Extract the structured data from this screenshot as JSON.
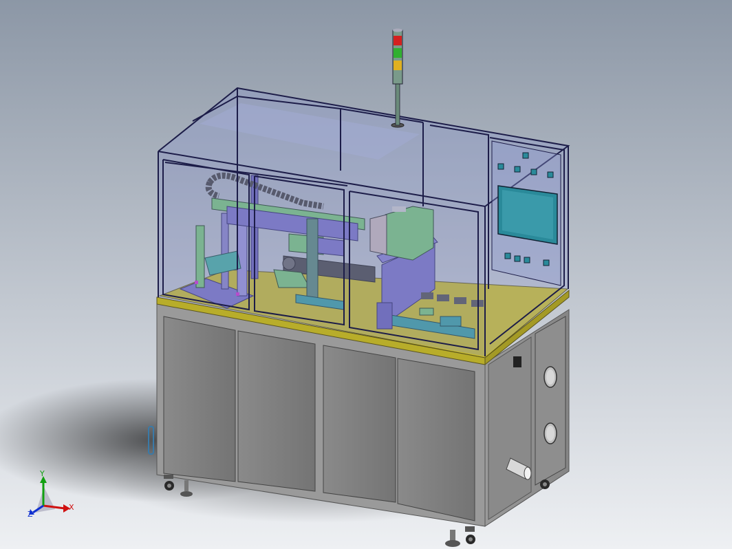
{
  "viewport": {
    "background_top": "#8c97a6",
    "background_bottom": "#eef0f3"
  },
  "colors": {
    "guard_frame": "#1c1c48",
    "guard_glass": "#7f89c4",
    "base_panel": "#7d7d7d",
    "base_frame": "#a9a9a9",
    "deck_yellow": "#c9bd2e",
    "machine_purple": "#7b74c6",
    "machine_green": "#79c77a",
    "machine_teal": "#3aa0a0",
    "hmi_screen": "#2a8a9a",
    "light_red": "#d42020",
    "light_amber": "#e0b020",
    "light_green": "#30b030"
  },
  "triad": {
    "x_label": "X",
    "y_label": "Y",
    "z_label": "Z",
    "x_color": "#d01010",
    "y_color": "#10a010",
    "z_color": "#1030d0"
  },
  "model": {
    "name": "automated-assembly-station",
    "tower_light_segments": [
      "red",
      "amber",
      "green"
    ]
  }
}
